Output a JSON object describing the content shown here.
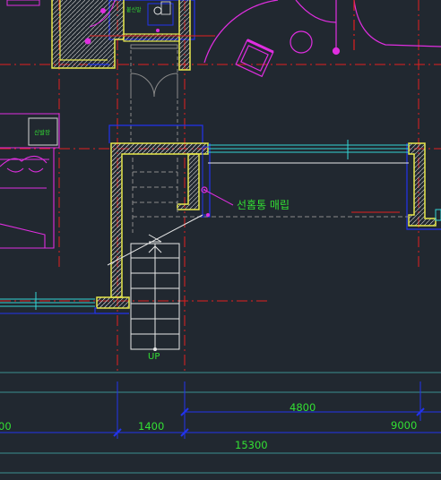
{
  "colors": {
    "background": "#212830",
    "wall_outline": "#e8e84a",
    "hatch": "#c9c9c9",
    "red": "#e21f1f",
    "cyan": "#33d4d4",
    "magenta": "#e02ee0",
    "blue": "#2233ee",
    "green_text": "#33e033",
    "white": "#e8e8e8",
    "dim_line": "#3b8f8f"
  },
  "labels": {
    "annotation": "선홈통 매립",
    "stair_up": "UP",
    "room_tag_top": "붙신발",
    "room_tag_left": "신발장"
  },
  "dimensions": {
    "d_left": "00",
    "d_1400": "1400",
    "d_4800": "4800",
    "d_9000": "9000",
    "d_15300": "15300"
  }
}
